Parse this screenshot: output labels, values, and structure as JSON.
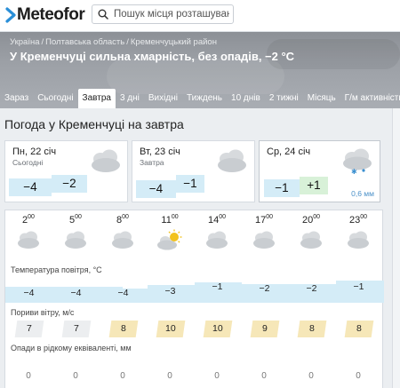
{
  "brand": {
    "name": "Meteofor"
  },
  "search": {
    "placeholder": "Пошук місця розташування"
  },
  "breadcrumbs": [
    "Україна",
    "Полтавська область",
    "Кременчуцький район"
  ],
  "headline": "У Кременчуці сильна хмарність, без опадів, −2 °C",
  "tabs": [
    "Зараз",
    "Сьогодні",
    "Завтра",
    "3 дні",
    "Вихідні",
    "Тиждень",
    "10 днів",
    "2 тижні",
    "Місяць",
    "Г/м активність"
  ],
  "active_tab": "Завтра",
  "section_title": "Погода у Кременчуці на завтра",
  "days": [
    {
      "date": "Пн, 22 січ",
      "sub": "Сьогодні",
      "min": "−4",
      "max": "−2",
      "icon": "cloudy-icon",
      "precip": ""
    },
    {
      "date": "Вт, 23 січ",
      "sub": "Завтра",
      "min": "−4",
      "max": "−1",
      "icon": "cloudy-icon",
      "precip": ""
    },
    {
      "date": "Ср, 24 січ",
      "sub": "",
      "min": "−1",
      "max": "+1",
      "icon": "snow-cloud-icon",
      "precip": "0,6 мм"
    }
  ],
  "hourly": {
    "hours": [
      "2",
      "5",
      "8",
      "11",
      "14",
      "17",
      "20",
      "23"
    ],
    "minutes": "00",
    "icons": [
      "cloudy-icon",
      "cloudy-icon",
      "cloudy-icon",
      "partly-cloudy-icon",
      "cloudy-icon",
      "cloudy-icon",
      "cloudy-icon",
      "cloudy-icon"
    ],
    "temperature_label": "Температура повітря, °C",
    "temperatures": [
      "−4",
      "−4",
      "−4",
      "−3",
      "−1",
      "−2",
      "−2",
      "−1"
    ],
    "wind_label": "Пориви вітру, м/с",
    "wind": [
      "7",
      "7",
      "8",
      "10",
      "10",
      "9",
      "8",
      "8"
    ],
    "precip_label": "Опади в рідкому еквіваленті, мм",
    "precip": [
      "0",
      "0",
      "0",
      "0",
      "0",
      "0",
      "0",
      "0"
    ]
  },
  "colors": {
    "cold": "#d4ecf7",
    "warm": "#d8f1d8",
    "wind_low": "#eceef0",
    "wind_mid": "#f6e7b8",
    "accent": "#4a90c8"
  }
}
